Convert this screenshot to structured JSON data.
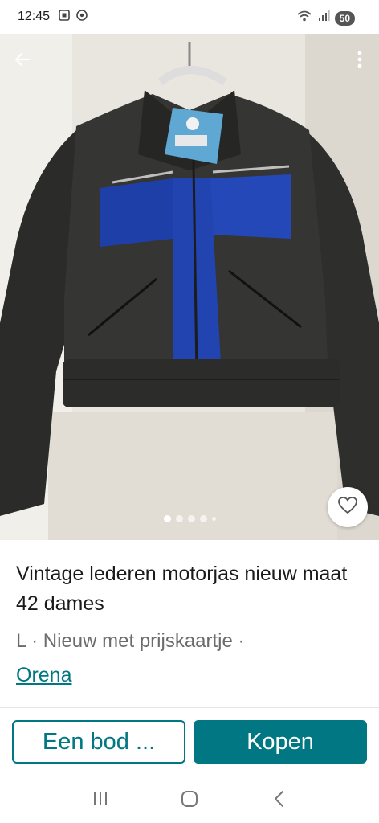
{
  "status_bar": {
    "time": "12:45",
    "battery": "50",
    "left_icons": [
      "screenshot-icon",
      "vpn-icon"
    ],
    "right_icons": [
      "wifi-icon",
      "signal-icon"
    ]
  },
  "photo": {
    "alt": "Vintage lederen motorjas",
    "carousel": {
      "count": 5,
      "active_index": 0
    },
    "actions": {
      "back_icon": "arrow-left-icon",
      "more_icon": "more-vertical-icon",
      "favorite_icon": "heart-icon"
    }
  },
  "listing": {
    "title": "Vintage lederen motorjas nieuw maat 42 dames",
    "meta": "L · Nieuw met prijskaartje ·",
    "seller": "Orena"
  },
  "actions": {
    "offer_label": "Een bod ...",
    "buy_label": "Kopen"
  },
  "colors": {
    "brand": "#007782",
    "meta_text": "#6b6b6b"
  },
  "nav_bar": {
    "icons": [
      "recent-apps-icon",
      "home-icon",
      "back-icon"
    ]
  }
}
